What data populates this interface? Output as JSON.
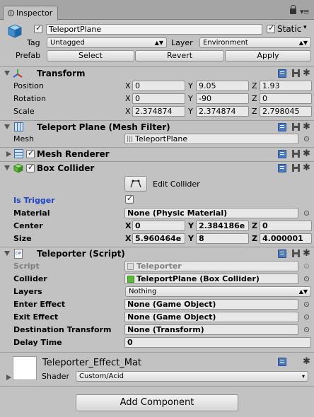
{
  "tab": {
    "title": "Inspector"
  },
  "gameobject": {
    "name": "TeleportPlane",
    "static_label": "Static",
    "tag_label": "Tag",
    "tag_value": "Untagged",
    "layer_label": "Layer",
    "layer_value": "Environment",
    "prefab_label": "Prefab",
    "select_label": "Select",
    "revert_label": "Revert",
    "apply_label": "Apply"
  },
  "transform": {
    "title": "Transform",
    "position_label": "Position",
    "rotation_label": "Rotation",
    "scale_label": "Scale",
    "x": "X",
    "y": "Y",
    "z": "Z",
    "position": [
      "0",
      "9.05",
      "1.93"
    ],
    "rotation": [
      "0",
      "-90",
      "0"
    ],
    "scale": [
      "2.374874",
      "2.374874",
      "2.798045"
    ]
  },
  "mesh_filter": {
    "title": "Teleport Plane (Mesh Filter)",
    "mesh_label": "Mesh",
    "mesh_value": "TeleportPlane"
  },
  "mesh_renderer": {
    "title": "Mesh Renderer"
  },
  "box_collider": {
    "title": "Box Collider",
    "edit_label": "Edit Collider",
    "is_trigger_label": "Is Trigger",
    "material_label": "Material",
    "material_value": "None (Physic Material)",
    "center_label": "Center",
    "size_label": "Size",
    "center": [
      "0",
      "2.384186e",
      "0"
    ],
    "size": [
      "5.960464e",
      "8",
      "4.000001"
    ]
  },
  "teleporter": {
    "title": "Teleporter (Script)",
    "script_label": "Script",
    "script_value": "Teleporter",
    "collider_label": "Collider",
    "collider_value": "TeleportPlane (Box Collider)",
    "layers_label": "Layers",
    "layers_value": "Nothing",
    "enter_label": "Enter Effect",
    "enter_value": "None (Game Object)",
    "exit_label": "Exit Effect",
    "exit_value": "None (Game Object)",
    "dest_label": "Destination Transform",
    "dest_value": "None (Transform)",
    "delay_label": "Delay Time",
    "delay_value": "0"
  },
  "material": {
    "name": "Teleporter_Effect_Mat",
    "shader_label": "Shader",
    "shader_value": "Custom/Acid"
  },
  "add_component_label": "Add Component",
  "colors": {
    "accent_blue": "#1f45c8",
    "panel_bg": "#c2c2c2"
  }
}
